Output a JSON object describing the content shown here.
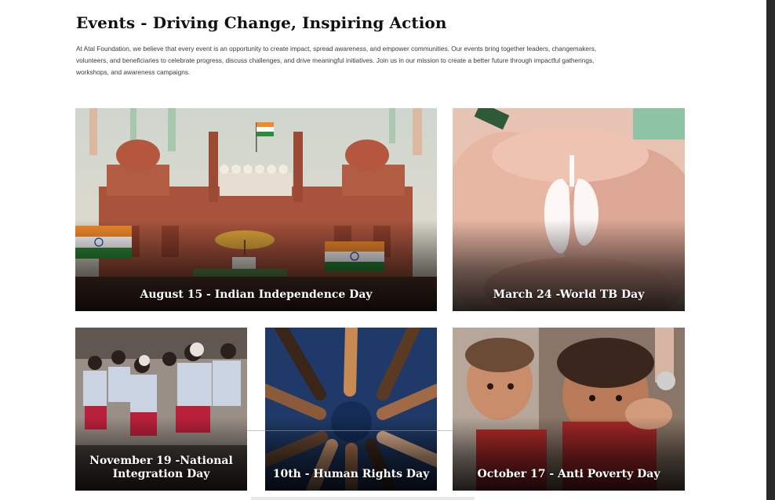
{
  "page": {
    "title": "Events - Driving Change, Inspiring Action",
    "intro": "At Atal Foundation, we believe that every event is an opportunity to create impact, spread awareness, and empower communities. Our events bring together leaders, changemakers, volunteers, and beneficiaries to celebrate progress, discuss challenges, and drive meaningful initiatives. Join us in our mission to create a better future through impactful gatherings, workshops, and awareness campaigns."
  },
  "events": [
    {
      "label": "August 15 - Indian Independence Day"
    },
    {
      "label": "March 24 -World TB Day"
    },
    {
      "label": "November 19 -National Integration Day"
    },
    {
      "label": "10th - Human Rights Day"
    },
    {
      "label": "October 17 - Anti Poverty Day"
    }
  ],
  "colors": {
    "background": "#ffffff",
    "heading": "#111111",
    "body_text": "#3a3a3a",
    "caption_text": "#ffffff",
    "scrollbar": "#2b2b2b"
  }
}
